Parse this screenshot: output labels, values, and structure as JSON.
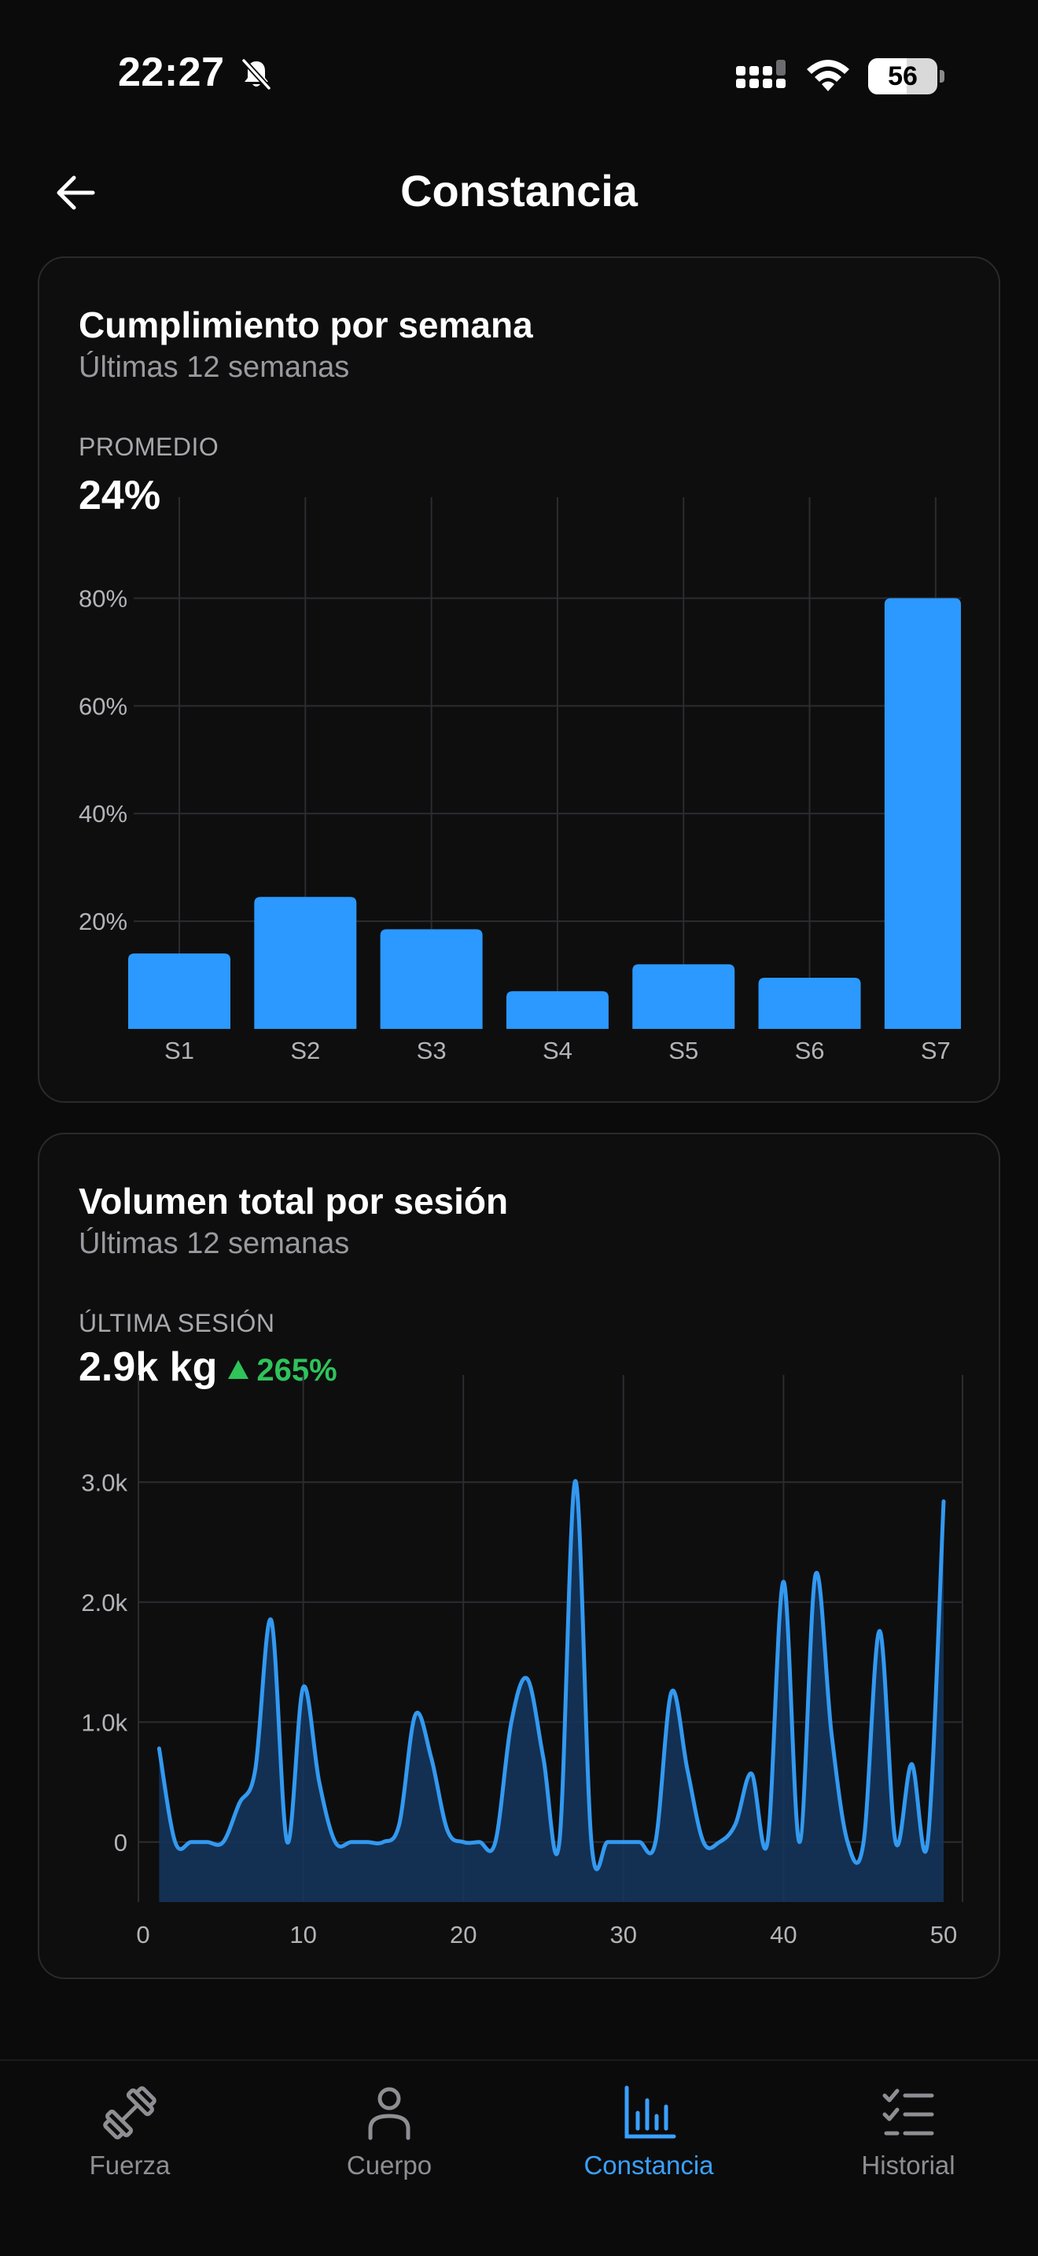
{
  "status_bar": {
    "time": "22:27",
    "battery_level": "56",
    "battery_fraction": 0.56
  },
  "header": {
    "title": "Constancia",
    "back_icon": "arrow-left-icon"
  },
  "weekly_card": {
    "title": "Cumplimiento por semana",
    "subtitle": "Últimas 12 semanas",
    "metric_label": "PROMEDIO",
    "metric_value": "24%"
  },
  "volume_card": {
    "title": "Volumen total por sesión",
    "subtitle": "Últimas 12 semanas",
    "metric_label": "ÚLTIMA SESIÓN",
    "metric_value": "2.9k kg",
    "delta": "265%",
    "delta_icon": "triangle-up-icon"
  },
  "chart_data": [
    {
      "type": "bar",
      "categories": [
        "S1",
        "S2",
        "S3",
        "S4",
        "S5",
        "S6",
        "S7"
      ],
      "values": [
        14,
        24.5,
        18.5,
        7,
        12,
        9.5,
        80
      ],
      "ylim": [
        0,
        90
      ],
      "yticks": [
        20,
        40,
        60,
        80
      ],
      "ytick_labels": [
        "20%",
        "40%",
        "60%",
        "80%"
      ],
      "grid": true,
      "color": "#2b99ff"
    },
    {
      "type": "area",
      "x": [
        1,
        2,
        3,
        4,
        5,
        6,
        7,
        8,
        9,
        10,
        11,
        12,
        13,
        14,
        15,
        16,
        17,
        18,
        19,
        20,
        21,
        22,
        23,
        24,
        25,
        26,
        27,
        28,
        29,
        30,
        31,
        32,
        33,
        34,
        35,
        36,
        37,
        38,
        39,
        40,
        41,
        42,
        43,
        44,
        45,
        46,
        47,
        48,
        49,
        50
      ],
      "values": [
        780,
        0,
        0,
        0,
        0,
        320,
        600,
        1850,
        0,
        1290,
        500,
        0,
        0,
        0,
        0,
        150,
        1060,
        700,
        100,
        0,
        0,
        0,
        1000,
        1360,
        700,
        0,
        3010,
        0,
        0,
        0,
        0,
        0,
        1250,
        600,
        0,
        0,
        150,
        570,
        0,
        2170,
        0,
        2230,
        900,
        0,
        0,
        1760,
        0,
        650,
        0,
        2840
      ],
      "xlim": [
        0,
        50
      ],
      "xticks": [
        0,
        10,
        20,
        30,
        40,
        50
      ],
      "ylim": [
        -500,
        3500
      ],
      "yticks": [
        0,
        1000,
        2000,
        3000
      ],
      "ytick_labels": [
        "0",
        "1.0k",
        "2.0k",
        "3.0k"
      ],
      "grid": true,
      "color": "#3399f0",
      "fill_color": "#14365e"
    }
  ],
  "bottom_nav": {
    "items": [
      {
        "label": "Fuerza",
        "icon": "dumbbell-icon",
        "active": false
      },
      {
        "label": "Cuerpo",
        "icon": "person-icon",
        "active": false
      },
      {
        "label": "Constancia",
        "icon": "bar-chart-icon",
        "active": true
      },
      {
        "label": "Historial",
        "icon": "checklist-icon",
        "active": false
      }
    ]
  }
}
